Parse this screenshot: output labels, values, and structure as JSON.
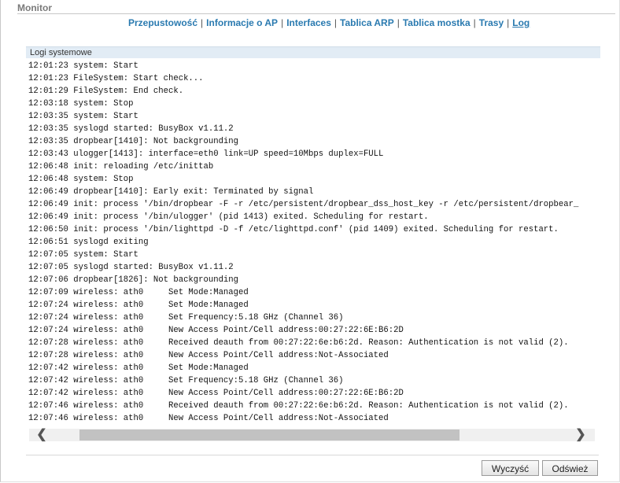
{
  "header": {
    "title": "Monitor"
  },
  "nav": {
    "items": [
      {
        "label": "Przepustowość"
      },
      {
        "label": "Informacje o AP"
      },
      {
        "label": "Interfaces"
      },
      {
        "label": "Tablica ARP"
      },
      {
        "label": "Tablica mostka"
      },
      {
        "label": "Trasy"
      },
      {
        "label": "Log"
      }
    ],
    "separator": "|"
  },
  "log": {
    "title": "Logi systemowe",
    "lines": [
      "12:01:23 system: Start",
      "12:01:23 FileSystem: Start check...",
      "12:01:29 FileSystem: End check.",
      "12:03:18 system: Stop",
      "12:03:35 system: Start",
      "12:03:35 syslogd started: BusyBox v1.11.2",
      "12:03:35 dropbear[1410]: Not backgrounding",
      "12:03:43 ulogger[1413]: interface=eth0 link=UP speed=10Mbps duplex=FULL",
      "12:06:48 init: reloading /etc/inittab",
      "12:06:48 system: Stop",
      "12:06:49 dropbear[1410]: Early exit: Terminated by signal",
      "12:06:49 init: process '/bin/dropbear -F -r /etc/persistent/dropbear_dss_host_key -r /etc/persistent/dropbear_",
      "12:06:49 init: process '/bin/ulogger' (pid 1413) exited. Scheduling for restart.",
      "12:06:50 init: process '/bin/lighttpd -D -f /etc/lighttpd.conf' (pid 1409) exited. Scheduling for restart.",
      "12:06:51 syslogd exiting",
      "12:07:05 system: Start",
      "12:07:05 syslogd started: BusyBox v1.11.2",
      "12:07:06 dropbear[1826]: Not backgrounding",
      "12:07:09 wireless: ath0     Set Mode:Managed",
      "12:07:24 wireless: ath0     Set Mode:Managed",
      "12:07:24 wireless: ath0     Set Frequency:5.18 GHz (Channel 36)",
      "12:07:24 wireless: ath0     New Access Point/Cell address:00:27:22:6E:B6:2D",
      "12:07:28 wireless: ath0     Received deauth from 00:27:22:6e:b6:2d. Reason: Authentication is not valid (2).",
      "12:07:28 wireless: ath0     New Access Point/Cell address:Not-Associated",
      "12:07:42 wireless: ath0     Set Mode:Managed",
      "12:07:42 wireless: ath0     Set Frequency:5.18 GHz (Channel 36)",
      "12:07:42 wireless: ath0     New Access Point/Cell address:00:27:22:6E:B6:2D",
      "12:07:46 wireless: ath0     Received deauth from 00:27:22:6e:b6:2d. Reason: Authentication is not valid (2).",
      "12:07:46 wireless: ath0     New Access Point/Cell address:Not-Associated"
    ]
  },
  "scrollbar": {
    "left_glyph": "❮",
    "right_glyph": "❯"
  },
  "buttons": {
    "clear": "Wyczyść",
    "refresh": "Odśwież"
  }
}
